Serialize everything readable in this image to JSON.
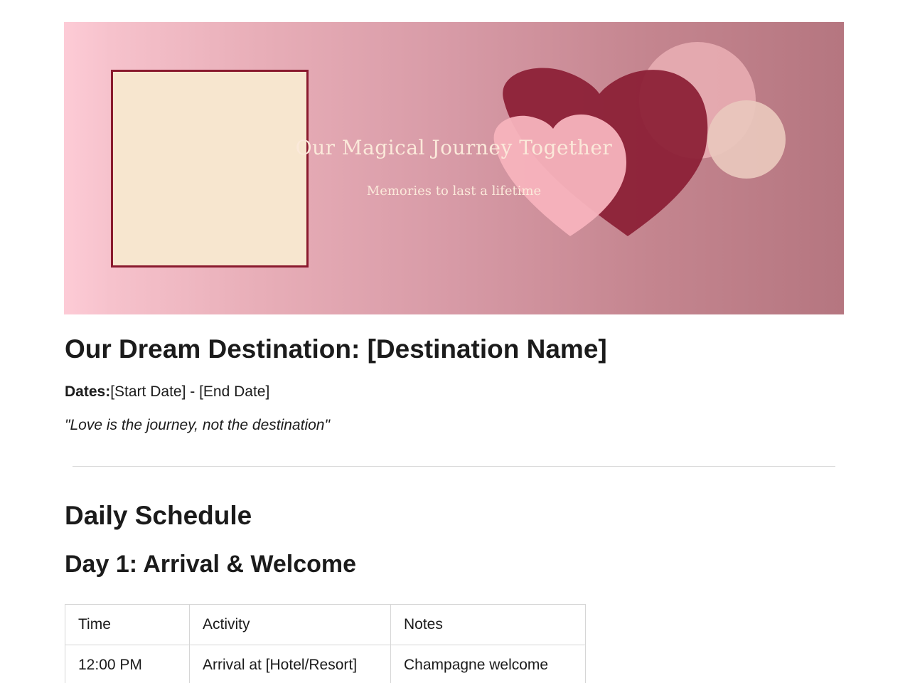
{
  "banner": {
    "title": "Our Magical Journey Together",
    "subtitle": "Memories to last a lifetime",
    "colors": {
      "gradient_start": "#fdcbd6",
      "gradient_end": "#b57680",
      "photo_placeholder": "#f7e6cf",
      "frame_border": "#8a1a2e",
      "heart_dark": "#8b1e35",
      "heart_light": "#f7b3bd",
      "circle_light": "#e8adb3",
      "circle_cream": "#e9c8bd"
    },
    "decorations": [
      "photo-placeholder",
      "heart-icon",
      "heart-icon",
      "circle",
      "circle"
    ]
  },
  "document": {
    "title": "Our Dream Destination: [Destination Name]",
    "dates_label": "Dates:",
    "dates_value": "[Start Date] - [End Date]",
    "quote": "\"Love is the journey, not the destination\""
  },
  "schedule": {
    "section_title": "Daily Schedule",
    "day_title": "Day 1: Arrival & Welcome",
    "columns": [
      "Time",
      "Activity",
      "Notes"
    ],
    "rows": [
      [
        "12:00 PM",
        "Arrival at [Hotel/Resort]",
        "Champagne welcome"
      ]
    ]
  }
}
